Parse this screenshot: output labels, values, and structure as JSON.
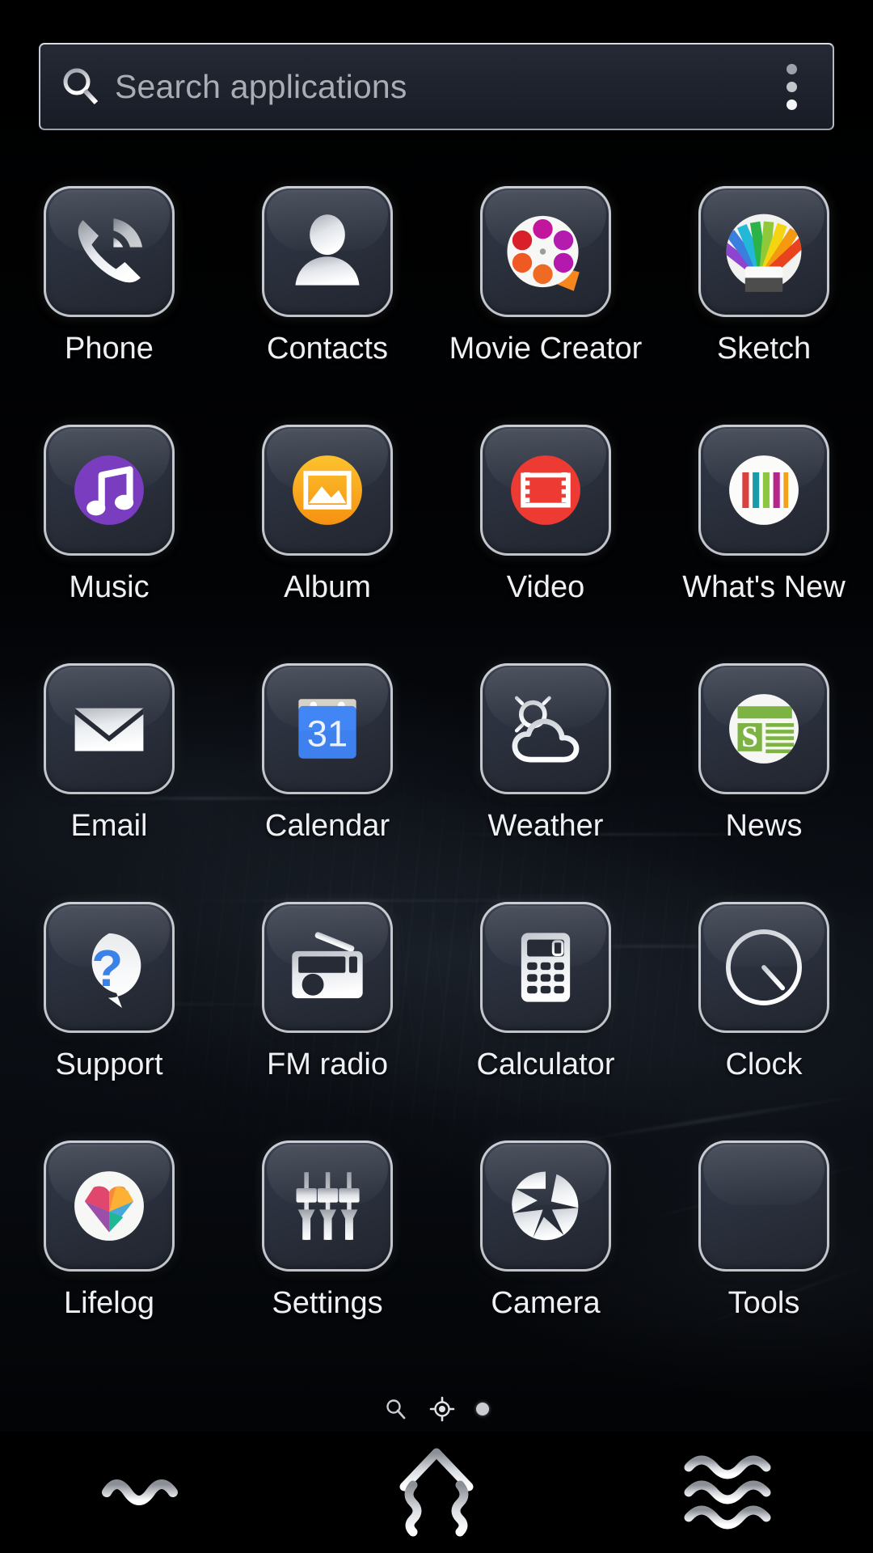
{
  "screen": {
    "type": "android-app-drawer",
    "background_color": "#000000",
    "tile_color": "#2b313e",
    "label_color": "#eef0f3"
  },
  "search": {
    "icon": "search-icon",
    "placeholder": "Search applications",
    "value": "",
    "overflow_icon": "overflow-menu-icon"
  },
  "apps": [
    {
      "label": "Phone",
      "icon": "phone-icon"
    },
    {
      "label": "Contacts",
      "icon": "contacts-icon"
    },
    {
      "label": "Movie Creator",
      "icon": "movie-creator-icon"
    },
    {
      "label": "Sketch",
      "icon": "sketch-icon"
    },
    {
      "label": "Music",
      "icon": "music-icon"
    },
    {
      "label": "Album",
      "icon": "album-icon"
    },
    {
      "label": "Video",
      "icon": "video-icon"
    },
    {
      "label": "What's New",
      "icon": "whats-new-icon"
    },
    {
      "label": "Email",
      "icon": "email-icon"
    },
    {
      "label": "Calendar",
      "icon": "calendar-icon"
    },
    {
      "label": "Weather",
      "icon": "weather-icon"
    },
    {
      "label": "News",
      "icon": "news-icon"
    },
    {
      "label": "Support",
      "icon": "support-icon"
    },
    {
      "label": "FM radio",
      "icon": "fm-radio-icon"
    },
    {
      "label": "Calculator",
      "icon": "calculator-icon"
    },
    {
      "label": "Clock",
      "icon": "clock-icon"
    },
    {
      "label": "Lifelog",
      "icon": "lifelog-icon"
    },
    {
      "label": "Settings",
      "icon": "settings-icon"
    },
    {
      "label": "Camera",
      "icon": "camera-icon"
    },
    {
      "label": "Tools",
      "icon": "tools-folder-icon"
    }
  ],
  "calendar_day": "31",
  "news_letter": "S",
  "page_indicator": {
    "items": [
      "search-page-icon",
      "apps-page-icon",
      "page-dot"
    ],
    "current_index": 1
  },
  "navbar": {
    "back_label": "Back",
    "home_label": "Home",
    "recents_label": "Recent apps"
  },
  "icon_colors": {
    "music_purple": "#7a3dc0",
    "album_orange": "#fbad17",
    "video_red": "#ed3b33",
    "calendar_blue": "#4285f4",
    "news_green": "#7cb342",
    "support_blue": "#3b82e8",
    "sketch_rainbow": [
      "#8e44d0",
      "#3a7fe0",
      "#23b7d8",
      "#2bb34a",
      "#8fc93a",
      "#f5d511",
      "#f59a10",
      "#e8421f"
    ],
    "whats_new_bars": [
      "#d9413f",
      "#1b9aaa",
      "#8dc63f",
      "#b5258c",
      "#f2a31b"
    ],
    "lifelog_heart": [
      "#e8527f",
      "#e13b5c",
      "#f98a3a",
      "#fcb034",
      "#9b4fa8",
      "#4aa8d8",
      "#1fb894"
    ]
  }
}
